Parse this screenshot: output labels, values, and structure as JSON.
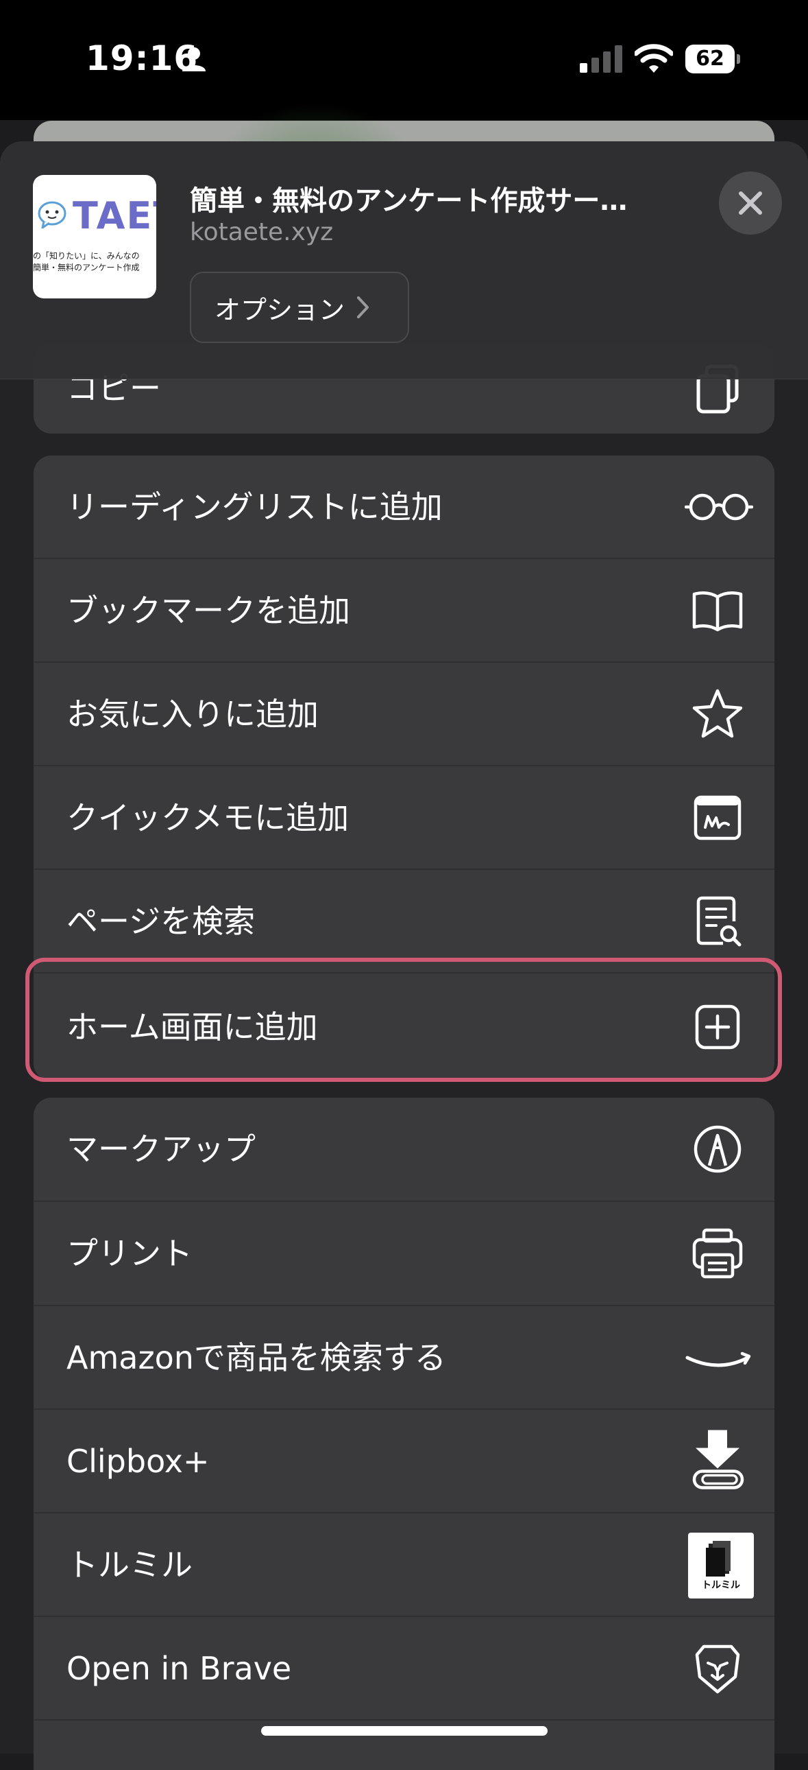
{
  "status_bar": {
    "time": "19:16",
    "battery": "62"
  },
  "header": {
    "title": "簡単・無料のアンケート作成サー…",
    "domain": "kotaete.xyz",
    "options_label": "オプション",
    "thumbnail": {
      "logo_text": "TAET",
      "line1": "の「知りたい」に、みんなの",
      "line2": "簡単・無料のアンケート作成"
    }
  },
  "partial_row": {
    "label": "コピー",
    "icon": "copy-icon"
  },
  "group1": [
    {
      "label": "リーディングリストに追加",
      "icon": "glasses-icon"
    },
    {
      "label": "ブックマークを追加",
      "icon": "book-icon"
    },
    {
      "label": "お気に入りに追加",
      "icon": "star-icon"
    },
    {
      "label": "クイックメモに追加",
      "icon": "quick-note-icon"
    },
    {
      "label": "ページを検索",
      "icon": "find-on-page-icon"
    },
    {
      "label": "ホーム画面に追加",
      "icon": "plus-square-icon"
    }
  ],
  "group2": [
    {
      "label": "マークアップ",
      "icon": "markup-icon"
    },
    {
      "label": "プリント",
      "icon": "printer-icon"
    },
    {
      "label": "Amazonで商品を検索する",
      "icon": "amazon-smile-icon"
    },
    {
      "label": "Clipbox+",
      "icon": "download-icon"
    },
    {
      "label": "トルミル",
      "icon": "torumiru-app-icon",
      "icon_text": "トルミル"
    },
    {
      "label": "Open in Brave",
      "icon": "brave-lion-icon"
    }
  ],
  "colors": {
    "highlight": "#d05a74",
    "cell": "#3a3a3c"
  }
}
